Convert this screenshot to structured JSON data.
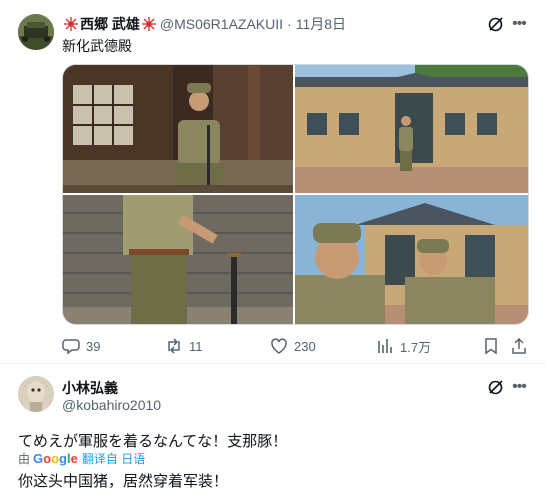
{
  "tweet": {
    "author_name": "西郷 武雄",
    "handle": "@MS06R1AZAKUII",
    "separator": "·",
    "time": "11月8日",
    "text": "新化武德殿",
    "flag_icon": "rising-sun-flag-icon",
    "stats": {
      "replies": "39",
      "retweets": "11",
      "likes": "230",
      "views": "1.7万"
    }
  },
  "reply": {
    "author_name": "小林弘義",
    "handle": "@kobahiro2010",
    "text": "てめえが軍服を着るなんてな！支那豚！",
    "translated_by_prefix": "由",
    "translated_by_brand": "Google",
    "translate_link": "翻译自 日语",
    "translation": "你这头中国猪，居然穿着军装！"
  },
  "colors": {
    "link": "#1d9bf0",
    "secondary_text": "#536471",
    "divider": "#eff3f4"
  }
}
